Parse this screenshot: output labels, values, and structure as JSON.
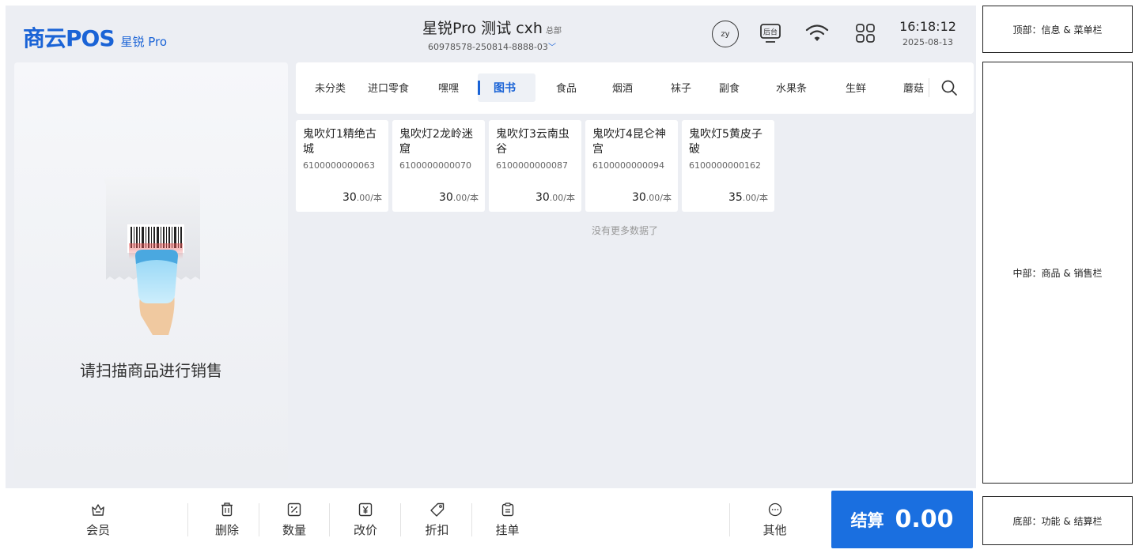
{
  "header": {
    "logo_main": "商云POS",
    "logo_sub": "星锐 Pro",
    "store_name": "星锐Pro 测试 cxh",
    "store_tag": "总部",
    "store_id": "60978578-250814-8888-03",
    "user_initials": "zy",
    "backoffice_label": "后台",
    "time": "16:18:12",
    "date": "2025-08-13"
  },
  "scan_panel": {
    "prompt": "请扫描商品进行销售"
  },
  "categories": [
    {
      "label": "未分类",
      "active": false
    },
    {
      "label": "进口零食",
      "active": false
    },
    {
      "label": "嘿嘿",
      "active": false
    },
    {
      "label": "图书",
      "active": true
    },
    {
      "label": "食品",
      "active": false
    },
    {
      "label": "烟酒",
      "active": false
    },
    {
      "label": "袜子",
      "active": false
    },
    {
      "label": "副食",
      "active": false
    },
    {
      "label": "水果条",
      "active": false
    },
    {
      "label": "生鲜",
      "active": false
    },
    {
      "label": "蘑菇",
      "active": false
    }
  ],
  "products": [
    {
      "name": "鬼吹灯1精绝古城",
      "code": "6100000000063",
      "price_int": "30",
      "price_dec": ".00",
      "unit": "/本"
    },
    {
      "name": "鬼吹灯2龙岭迷窟",
      "code": "6100000000070",
      "price_int": "30",
      "price_dec": ".00",
      "unit": "/本"
    },
    {
      "name": "鬼吹灯3云南虫谷",
      "code": "6100000000087",
      "price_int": "30",
      "price_dec": ".00",
      "unit": "/本"
    },
    {
      "name": "鬼吹灯4昆仑神宫",
      "code": "6100000000094",
      "price_int": "30",
      "price_dec": ".00",
      "unit": "/本"
    },
    {
      "name": "鬼吹灯5黄皮子破",
      "code": "6100000000162",
      "price_int": "35",
      "price_dec": ".00",
      "unit": "/本"
    }
  ],
  "no_more_text": "没有更多数据了",
  "footer": {
    "member": "会员",
    "delete": "删除",
    "quantity": "数量",
    "change_price": "改价",
    "discount": "折扣",
    "hold_order": "挂单",
    "other": "其他",
    "checkout_label": "结算",
    "checkout_amount": "0.00"
  },
  "annotations": {
    "top": "顶部：信息 & 菜单栏",
    "middle": "中部：商品 & 销售栏",
    "bottom": "底部：功能 & 结算栏"
  },
  "colors": {
    "accent": "#1a6fe0",
    "background": "#eceef3"
  }
}
